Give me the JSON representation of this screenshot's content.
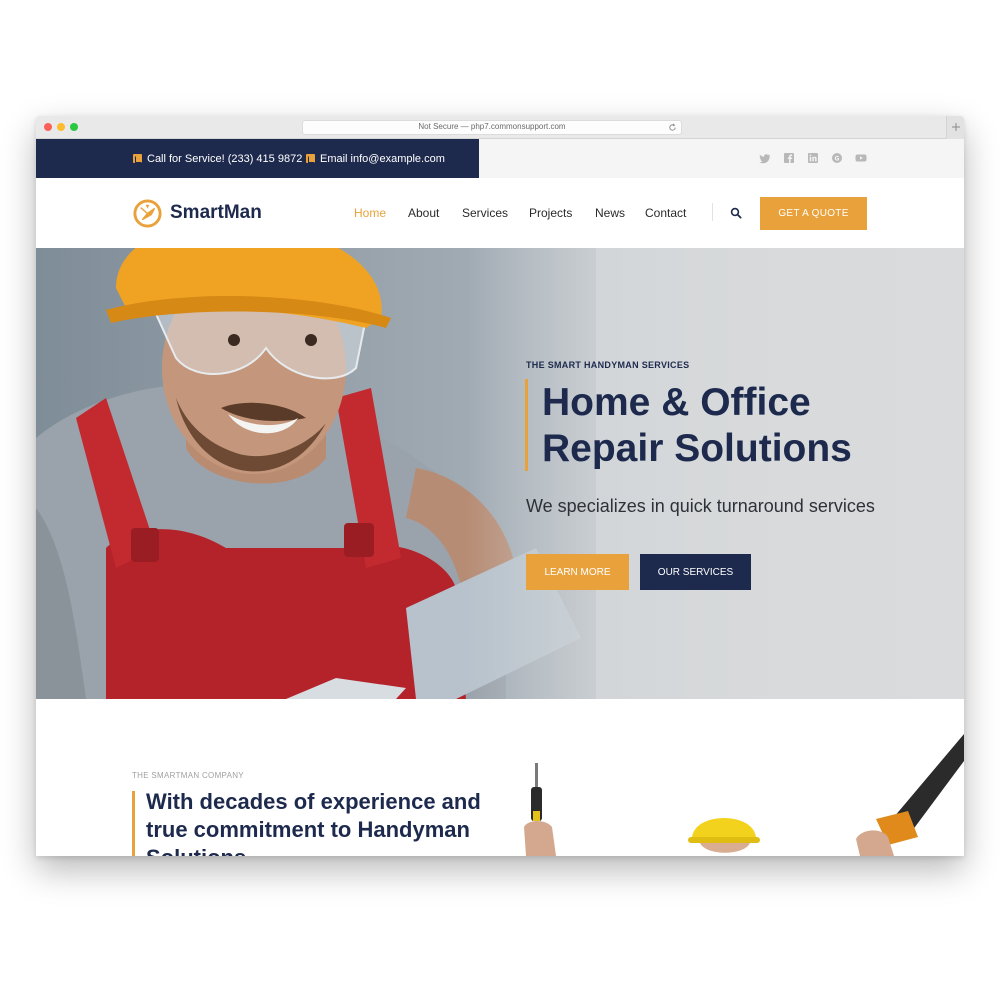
{
  "browser": {
    "url": "Not Secure — php7.commonsupport.com"
  },
  "topbar": {
    "phone": "Call for Service! (233) 415 9872",
    "email": "Email info@example.com",
    "social": [
      "twitter-icon",
      "facebook-icon",
      "linkedin-icon",
      "google-plus-icon",
      "youtube-icon"
    ]
  },
  "header": {
    "logo": "SmartMan",
    "nav": [
      "Home",
      "About",
      "Services",
      "Projects",
      "News",
      "Contact"
    ],
    "active": "Home",
    "quote_label": "GET A QUOTE"
  },
  "hero": {
    "eyebrow": "THE SMART HANDYMAN SERVICES",
    "title_line1": "Home & Office",
    "title_line2": "Repair Solutions",
    "subtitle": "We specializes in quick turnaround services",
    "learn_more": "LEARN MORE",
    "our_services": "OUR SERVICES"
  },
  "about": {
    "eyebrow": "THE SMARTMAN COMPANY",
    "title": "With decades of experience and true commitment to Handyman Solutions"
  },
  "colors": {
    "navy": "#1d2a4d",
    "accent": "#e9a23b"
  }
}
